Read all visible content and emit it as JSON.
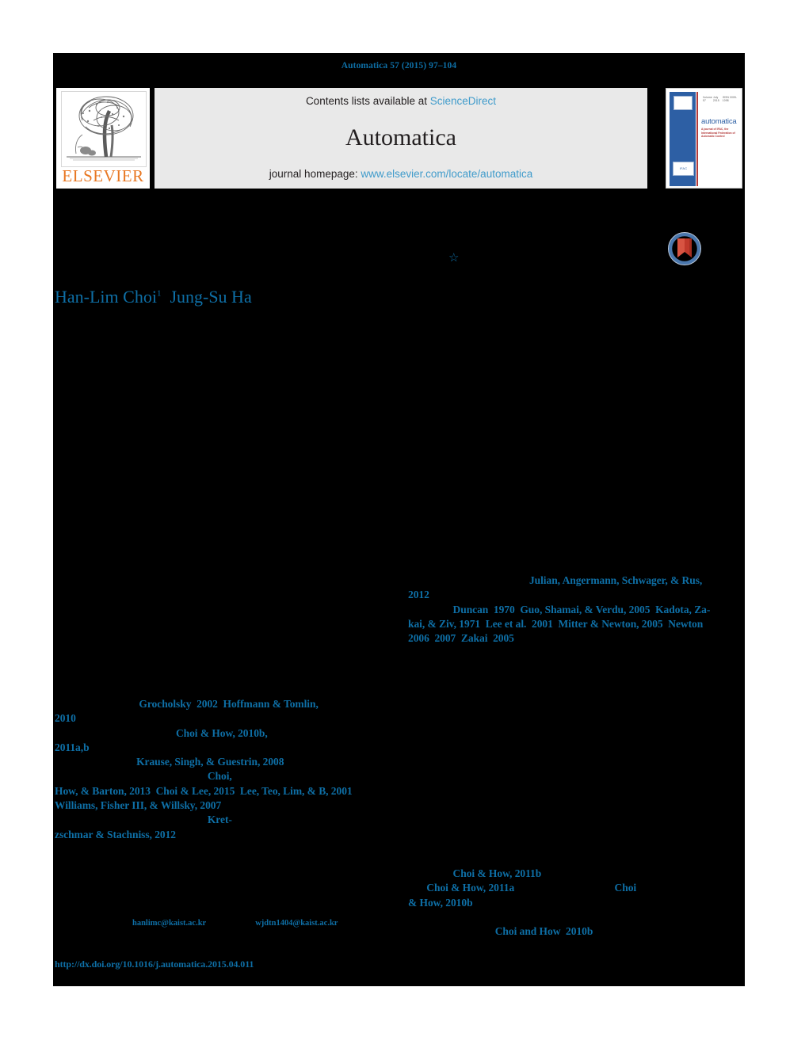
{
  "running_head": "Automatica 57 (2015) 97–104",
  "masthead": {
    "elsevier_logo_word": "ELSEVIER",
    "elsevier_logo_icon": "elsevier-tree-logo",
    "contents_prefix": "Contents lists available at ",
    "sciencedirect_link": "ScienceDirect",
    "journal_title": "Automatica",
    "homepage_prefix": "journal homepage: ",
    "homepage_link": "www.elsevier.com/locate/automatica",
    "cover": {
      "title": "automatica",
      "subtitle": "A journal of IFAC, the International\nFederation of Automatic Control",
      "top_left": "Volume 57",
      "top_mid": "July 2015",
      "top_right": "ISSN 0005-1098",
      "ifac_mark": "IFAC",
      "publisher_mark": "elsevier-mark"
    }
  },
  "crossmark": {
    "label": "CrossMark",
    "icon": "crossmark-badge-icon",
    "ring_color": "#4a77ad",
    "ribbon_color": "#c0392b"
  },
  "title_footnote_marker": "☆",
  "authors": {
    "name1": "Han-Lim Choi",
    "affil_marker1": "1",
    "name2": "Jung-Su Ha"
  },
  "colors": {
    "link_blue": "#0e6fa6",
    "light_blue": "#3f9bcb",
    "elsevier_orange": "#e87722",
    "page_bg": "#000000"
  },
  "references": {
    "right_top": "                                              Julian, Angermann, Schwager, & Rus,\n2012\n                 Duncan  1970  Guo, Shamai, & Verdu, 2005  Kadota, Za-\nkai, & Ziv, 1971  Lee et al.  2001  Mitter & Newton, 2005  Newton\n2006  2007  Zakai  2005",
    "left_mid": "                                Grocholsky  2002  Hoffmann & Tomlin,\n2010\n                                              Choi & How, 2010b,\n2011a,b\n                               Krause, Singh, & Guestrin, 2008\n                                                          Choi,\nHow, & Barton, 2013  Choi & Lee, 2015  Lee, Teo, Lim, & B, 2001\nWilliams, Fisher III, & Willsky, 2007\n                                                          Kret-\nzschmar & Stachniss, 2012",
    "right_low": "                 Choi & How, 2011b\n       Choi & How, 2011a                                      Choi\n& How, 2010b",
    "right_last": "                                 Choi and How  2010b"
  },
  "footnote_emails": {
    "email1": "hanlimc@kaist.ac.kr",
    "email2": "wjdtn1404@kaist.ac.kr"
  },
  "doi": "http://dx.doi.org/10.1016/j.automatica.2015.04.011"
}
